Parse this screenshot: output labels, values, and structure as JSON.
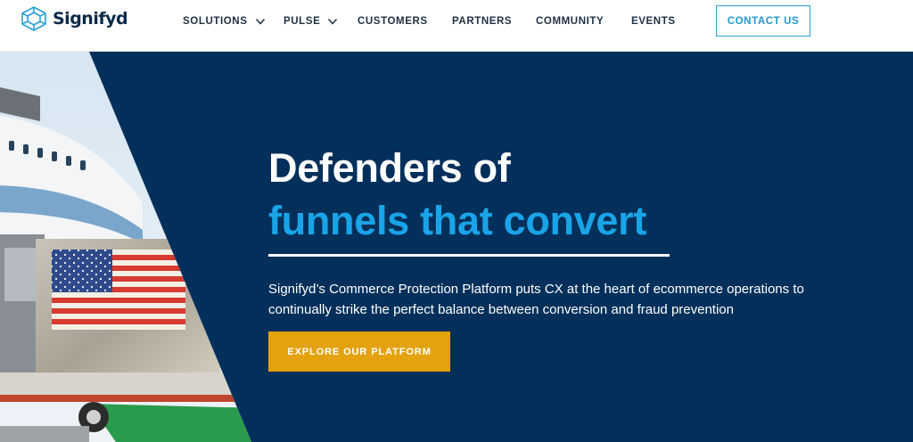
{
  "brand": {
    "name": "Signifyd",
    "logo_icon": "cube-logo-icon",
    "colors": {
      "navy": "#03305b",
      "accent_blue": "#19a4e8",
      "cta_gold": "#e4a20e"
    }
  },
  "nav": {
    "items": [
      {
        "label": "SOLUTIONS",
        "has_dropdown": true,
        "icon": "chevron-down-icon"
      },
      {
        "label": "PULSE",
        "has_dropdown": true,
        "icon": "chevron-down-icon"
      },
      {
        "label": "CUSTOMERS",
        "has_dropdown": false
      },
      {
        "label": "PARTNERS",
        "has_dropdown": false
      },
      {
        "label": "COMMUNITY",
        "has_dropdown": false
      },
      {
        "label": "EVENTS",
        "has_dropdown": false
      }
    ],
    "contact_label": "CONTACT US"
  },
  "hero": {
    "headline_line1": "Defenders of",
    "headline_line2": "funnels that convert",
    "description": "Signifyd’s Commerce Protection Platform puts CX at the heart of ecommerce operations to continually strike the perfect balance between conversion and fraud prevention",
    "cta_label": "EXPLORE OUR PLATFORM",
    "image_subject": "cargo-plane-loading-flag-container"
  }
}
